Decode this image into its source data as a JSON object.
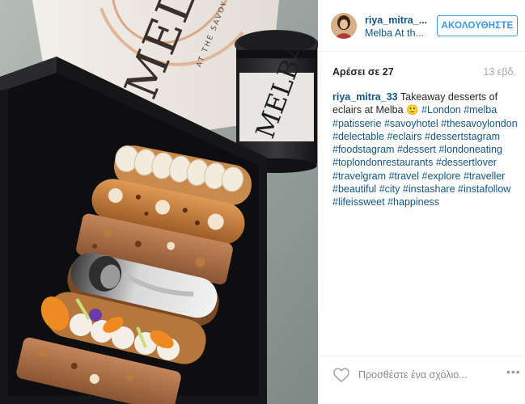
{
  "post": {
    "username": "riya_mitra_...",
    "location": "Melba At th...",
    "follow_label": "ΑΚΟΛΟΥΘΗΣΤΕ",
    "likes_text": "Αρέσει σε 27",
    "time_ago": "13 εβδ.",
    "caption_user": "riya_mitra_33",
    "caption_text": "Takeaway desserts of eclairs at Melba 🙂",
    "hashtags": [
      "#London",
      "#melba",
      "#patisserie",
      "#savoyhotel",
      "#thesavoylondon",
      "#delectable",
      "#eclairs",
      "#dessertstagram",
      "#foodstagram",
      "#dessert",
      "#londoneating",
      "#toplondonrestaurants",
      "#dessertlover",
      "#travelgram",
      "#travel",
      "#explore",
      "#traveller",
      "#beautiful",
      "#city",
      "#instashare",
      "#instafollow",
      "#lifeissweet",
      "#happiness"
    ],
    "comment_placeholder": "Προσθέστε ένα σχόλιο...",
    "more_glyph": "•••"
  },
  "photo": {
    "bag_brand_text": "MELBA",
    "bag_subtext": "AT THE SAVOY",
    "cup_text": "MELBA"
  },
  "colors": {
    "link_blue": "#125688",
    "follow_blue": "#3897f0",
    "muted": "#a5a7aa",
    "divider": "#efefef"
  },
  "icons": {
    "like": "heart-outline-icon",
    "more": "more-options-icon"
  }
}
